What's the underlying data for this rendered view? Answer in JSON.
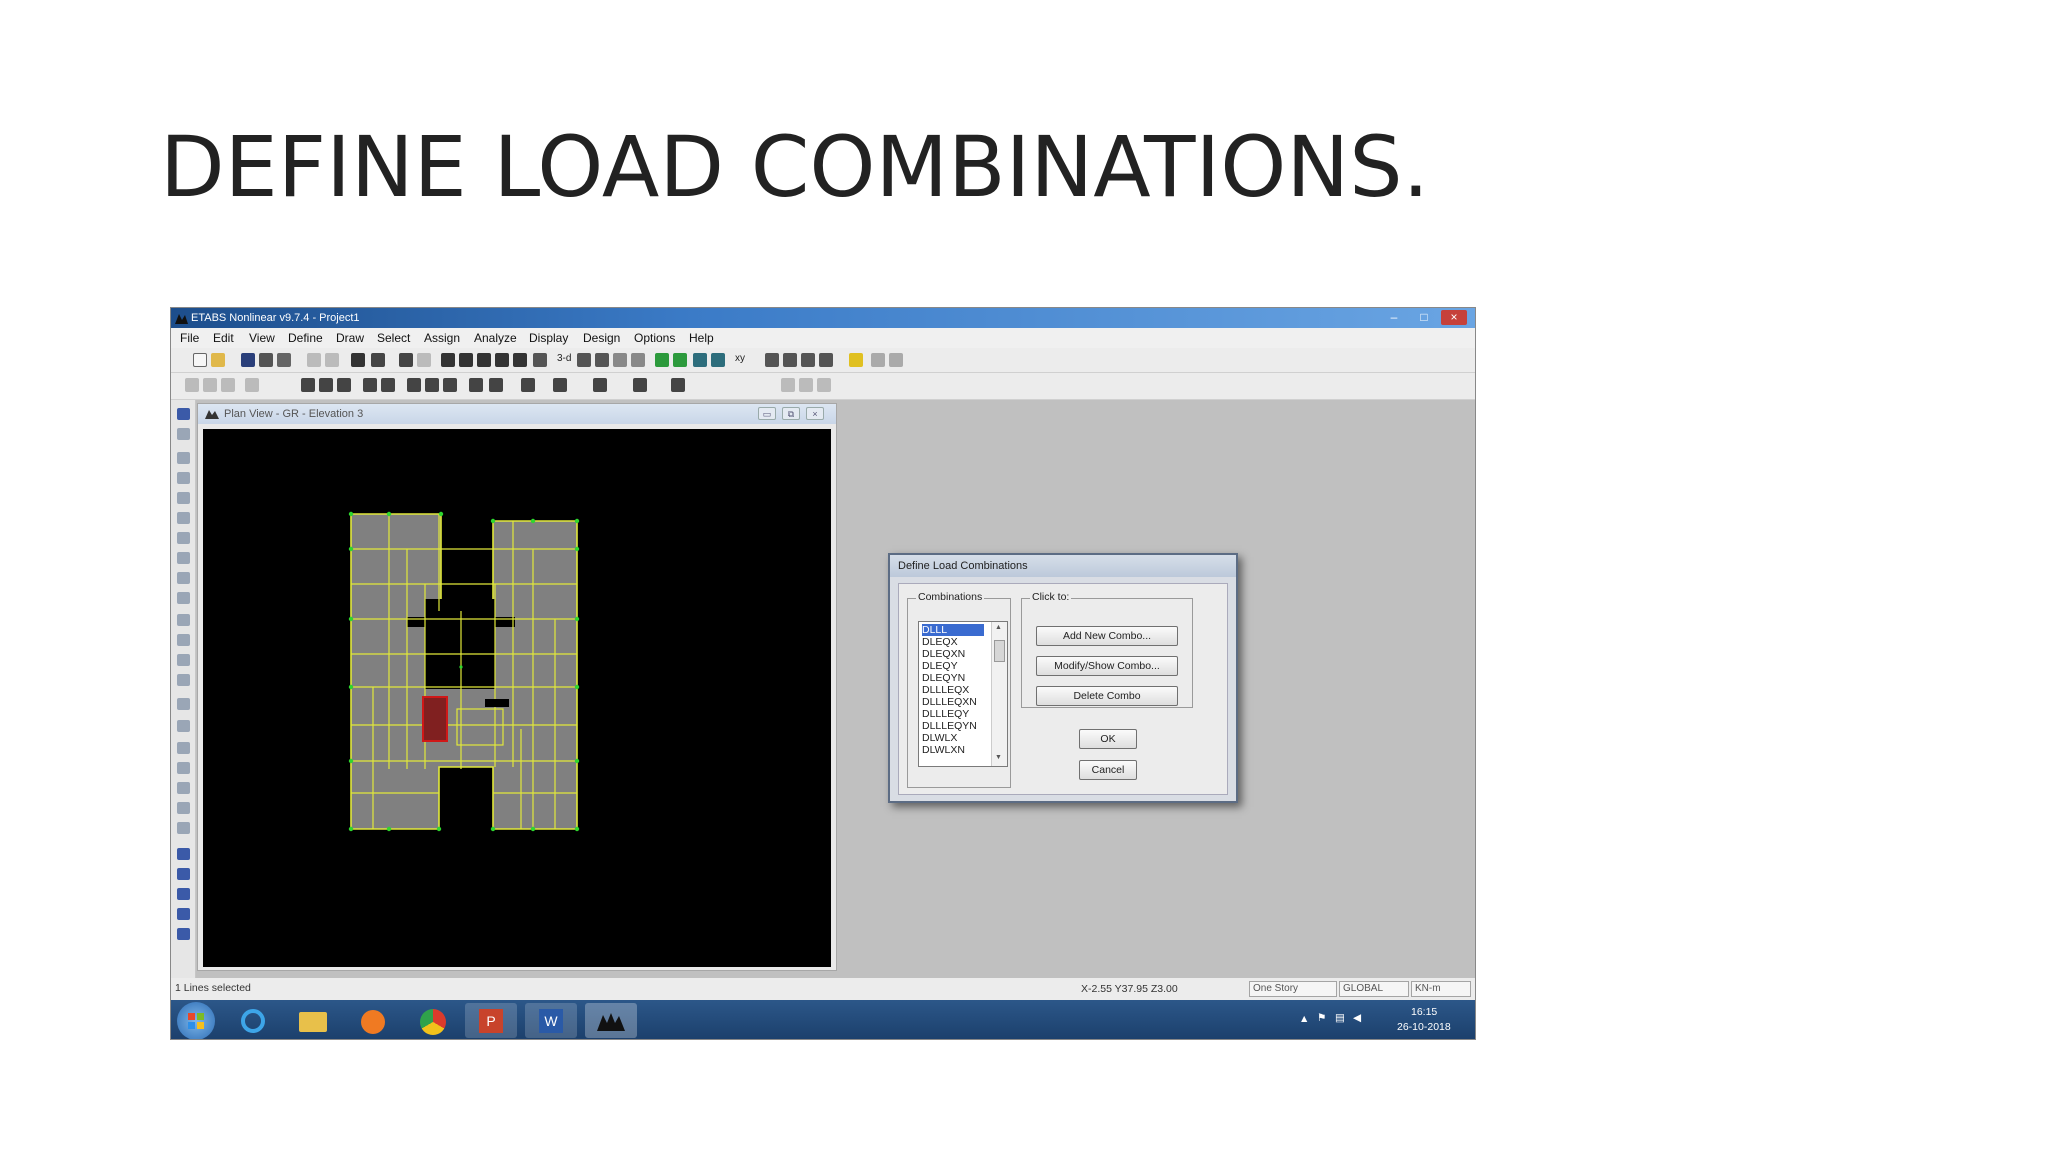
{
  "slide": {
    "title": "DEFINE LOAD COMBINATIONS."
  },
  "app": {
    "title": "ETABS Nonlinear v9.7.4 - Project1",
    "minimize": "–",
    "maximize": "□",
    "close": "×"
  },
  "menu": [
    "File",
    "Edit",
    "View",
    "Define",
    "Draw",
    "Select",
    "Assign",
    "Analyze",
    "Display",
    "Design",
    "Options",
    "Help"
  ],
  "toolbar": {
    "text_3d": "3-d",
    "text_xy": "xy"
  },
  "plan_window": {
    "title": "Plan View - GR - Elevation 3"
  },
  "dialog": {
    "title": "Define Load Combinations",
    "combinations_label": "Combinations",
    "clickto_label": "Click to:",
    "combinations": [
      "DLLL",
      "DLEQX",
      "DLEQXN",
      "DLEQY",
      "DLEQYN",
      "DLLLEQX",
      "DLLLEQXN",
      "DLLLEQY",
      "DLLLEQYN",
      "DLWLX",
      "DLWLXN"
    ],
    "selected_index": 0,
    "add_button": "Add New Combo...",
    "modify_button": "Modify/Show Combo...",
    "delete_button": "Delete Combo",
    "ok_button": "OK",
    "cancel_button": "Cancel"
  },
  "status": {
    "left": "1 Lines selected",
    "coords": "X-2.55  Y37.95  Z3.00",
    "story": "One Story",
    "coord_sys": "GLOBAL",
    "units": "KN-m"
  },
  "taskbar": {
    "time": "16:15",
    "date": "26-10-2018"
  },
  "colors": {
    "grid_line": "#e1e83a",
    "slab": "#808080",
    "selected": "#d01818",
    "canvas": "#000000",
    "node": "#2ed62e"
  }
}
